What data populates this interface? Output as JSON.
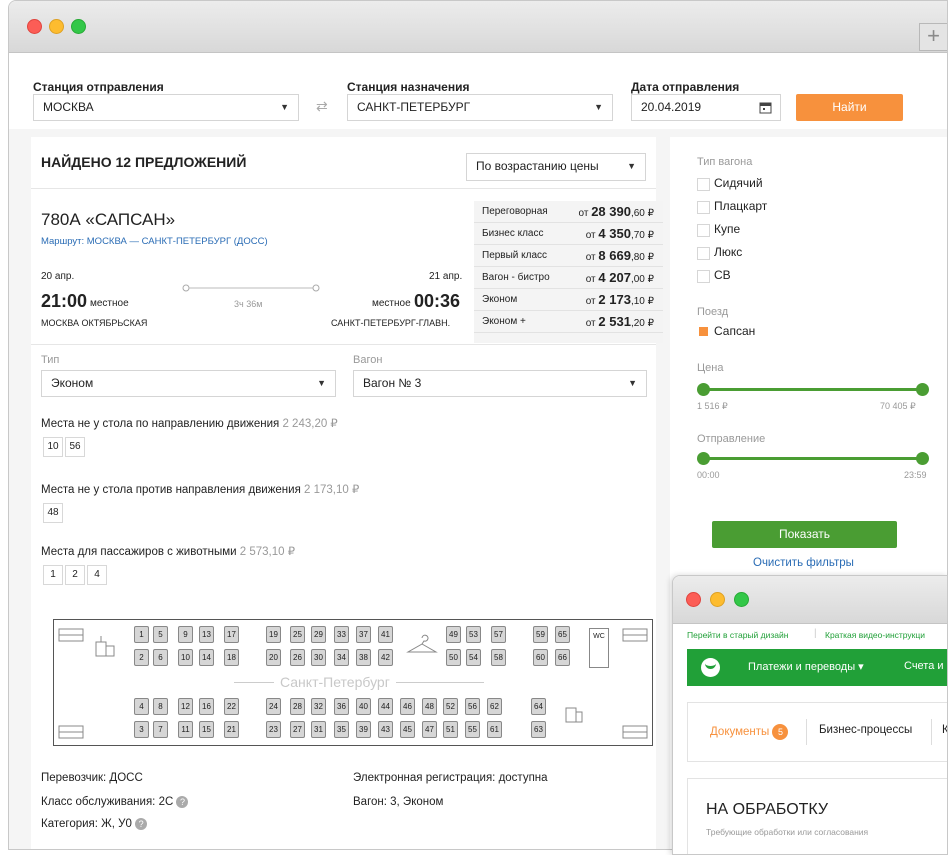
{
  "search": {
    "from_label": "Станция отправления",
    "from_value": "МОСКВА",
    "to_label": "Станция назначения",
    "to_value": "САНКТ-ПЕТЕРБУРГ",
    "date_label": "Дата отправления",
    "date_value": "20.04.2019",
    "find_button": "Найти"
  },
  "results": {
    "found": "НАЙДЕНО 12 ПРЕДЛОЖЕНИЙ",
    "sort": "По возрастанию цены"
  },
  "train": {
    "name": "780А «САПСАН»",
    "route": "Маршрут: МОСКВА — САНКТ-ПЕТЕРБУРГ (ДОСС)",
    "dep_date": "20 апр.",
    "dep_time": "21:00",
    "dep_tz": "местное",
    "dep_station": "МОСКВА ОКТЯБРЬСКАЯ",
    "duration": "3ч 36м",
    "arr_date": "21 апр.",
    "arr_time": "00:36",
    "arr_tz": "местное",
    "arr_station": "САНКТ-ПЕТЕРБУРГ-ГЛАВН."
  },
  "classes": [
    {
      "name": "Переговорная",
      "from": "от",
      "int": "28 390",
      "dec": ",60 ₽"
    },
    {
      "name": "Бизнес класс",
      "from": "от",
      "int": "4 350",
      "dec": ",70 ₽"
    },
    {
      "name": "Первый класс",
      "from": "от",
      "int": "8 669",
      "dec": ",80 ₽"
    },
    {
      "name": "Вагон - бистро",
      "from": "от",
      "int": "4 207",
      "dec": ",00 ₽"
    },
    {
      "name": "Эконом",
      "from": "от",
      "int": "2 173",
      "dec": ",10 ₽"
    },
    {
      "name": "Эконом +",
      "from": "от",
      "int": "2 531",
      "dec": ",20 ₽"
    }
  ],
  "choice": {
    "type_label": "Тип",
    "type_value": "Эконом",
    "car_label": "Вагон",
    "car_value": "Вагон № 3"
  },
  "seat_groups": [
    {
      "title": "Места не у стола по направлению движения",
      "price": "2 243,20 ₽",
      "seats": [
        "10",
        "56"
      ]
    },
    {
      "title": "Места не у стола против направления движения",
      "price": "2 173,10 ₽",
      "seats": [
        "48"
      ]
    },
    {
      "title": "Места для пассажиров с животными",
      "price": "2 573,10 ₽",
      "seats": [
        "1",
        "2",
        "4"
      ]
    }
  ],
  "car_map": {
    "label": "Санкт-Петербург",
    "wc": "WC",
    "top1": [
      "1",
      "5",
      "9",
      "13",
      "17",
      "19",
      "25",
      "29",
      "33",
      "37",
      "41",
      "49",
      "53",
      "57",
      "59",
      "65"
    ],
    "top2": [
      "2",
      "6",
      "10",
      "14",
      "18",
      "20",
      "26",
      "30",
      "34",
      "38",
      "42",
      "50",
      "54",
      "58",
      "60",
      "66"
    ],
    "bot1": [
      "4",
      "8",
      "12",
      "16",
      "22",
      "24",
      "28",
      "32",
      "36",
      "40",
      "44",
      "46",
      "48",
      "52",
      "56",
      "62",
      "64"
    ],
    "bot2": [
      "3",
      "7",
      "11",
      "15",
      "21",
      "23",
      "27",
      "31",
      "35",
      "39",
      "43",
      "45",
      "47",
      "51",
      "55",
      "61",
      "63"
    ]
  },
  "info": {
    "carrier": "Перевозчик: ДОСС",
    "service": "Класс обслуживания: 2С",
    "category": "Категория: Ж, У0",
    "ereg": "Электронная регистрация: доступна",
    "car": "Вагон: 3, Эконом"
  },
  "filters": {
    "car_type_title": "Тип вагона",
    "car_types": [
      "Сидячий",
      "Плацкарт",
      "Купе",
      "Люкс",
      "СВ"
    ],
    "train_title": "Поезд",
    "train_value": "Сапсан",
    "price_title": "Цена",
    "price_min": "1 516 ₽",
    "price_max": "70 405 ₽",
    "dep_title": "Отправление",
    "dep_min": "00:00",
    "dep_max": "23:59",
    "show_button": "Показать",
    "clear_link": "Очистить фильтры"
  },
  "bank": {
    "old_design": "Перейти в старый дизайн",
    "video": "Краткая видео-инструкци",
    "nav1": "Платежи и переводы ▾",
    "nav2": "Счета и",
    "tab_docs": "Документы",
    "docs_count": "5",
    "tab_bp": "Бизнес-процессы",
    "tab_k": "К",
    "heading": "НА ОБРАБОТКУ",
    "sub": "Требующие обработки или согласования"
  },
  "colors": {
    "accent_orange": "#f7913d",
    "green": "#4a9d33",
    "bank_green": "#21a038"
  }
}
